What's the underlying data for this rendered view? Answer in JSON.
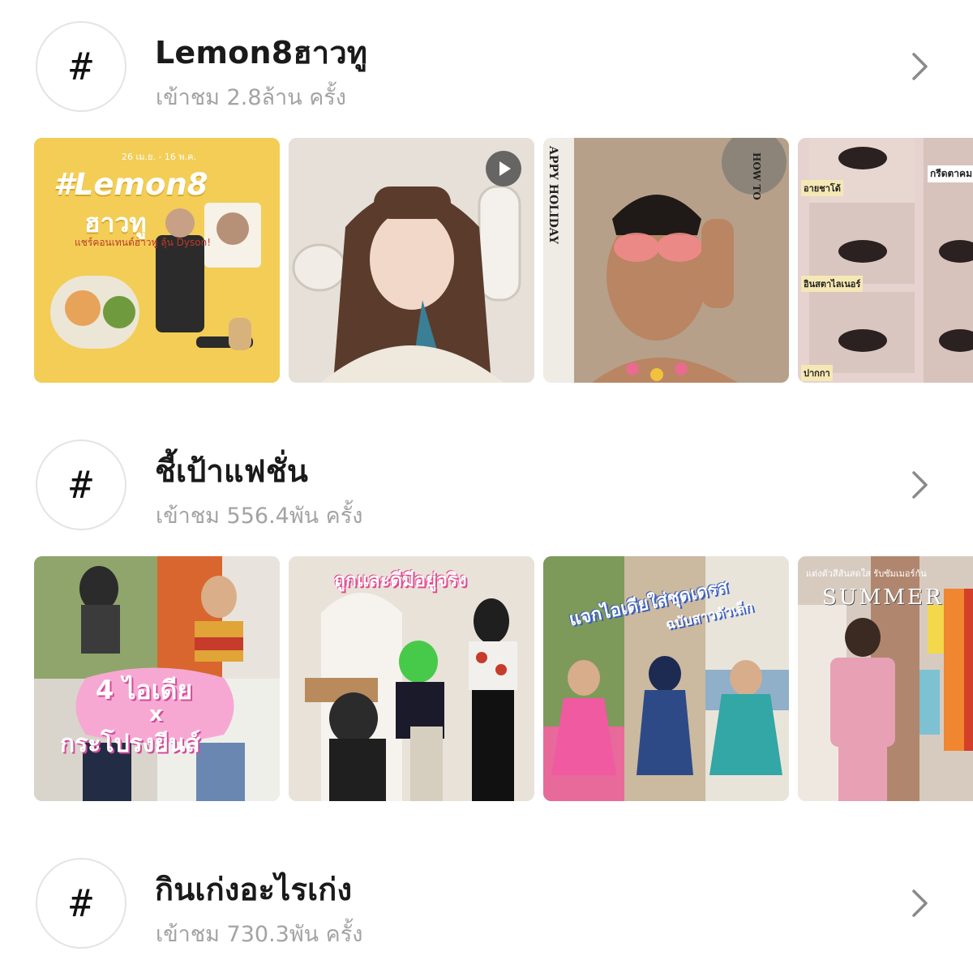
{
  "sections": [
    {
      "hash_symbol": "#",
      "title": "Lemon8ฮาวทู",
      "views": "เข้าชม 2.8ล้าน ครั้ง",
      "thumbnails": [
        {
          "caption": "#Lemon8",
          "caption2": "ฮาวทู",
          "caption3": "แชร์คอนเทนต์ฮาวทู ลุ้น Dyson!",
          "caption4": "26 เม.ย. - 16 พ.ค.",
          "bg": "#f2c94c"
        },
        {
          "caption": "",
          "bg": "#d9cfc4",
          "has_play": true
        },
        {
          "caption": "APPY HOLIDAY",
          "caption2": "HOW TO",
          "bg": "#e9e3d8"
        },
        {
          "caption": "อายชาโด้",
          "caption2": "กรีดตาคม สำหรับสาว",
          "caption3": "อินสตาไลเนอร์",
          "caption4": "ปากกา",
          "bg": "#e8d7d3"
        }
      ]
    },
    {
      "hash_symbol": "#",
      "title": "ชี้เป้าแฟชั่น",
      "views": "เข้าชม 556.4พัน ครั้ง",
      "thumbnails": [
        {
          "caption": "4 ไอเดีย",
          "caption2": "x",
          "caption3": "กระโปรงยีนส์",
          "bg": "#c9d4b8"
        },
        {
          "caption": "ถูกและดีมีอยู่จริง",
          "bg": "#e2ddd5"
        },
        {
          "caption": "แจกไอเดียใส่ชุดเดรส",
          "caption2": "ฉบับสาวตัวเล็ก",
          "bg": "#b9c6a4"
        },
        {
          "caption": "SUMMER",
          "caption2": "แต่งตัวสีสันสดใส รับซัมเมอร์กัน",
          "bg": "#d8b9a6"
        }
      ]
    },
    {
      "hash_symbol": "#",
      "title": "กินเก่งอะไรเก่ง",
      "views": "เข้าชม 730.3พัน ครั้ง",
      "thumbnails": []
    }
  ],
  "icons": {
    "hashtag": "hashtag-icon",
    "chevron": "chevron-right-icon",
    "play": "play-icon"
  }
}
